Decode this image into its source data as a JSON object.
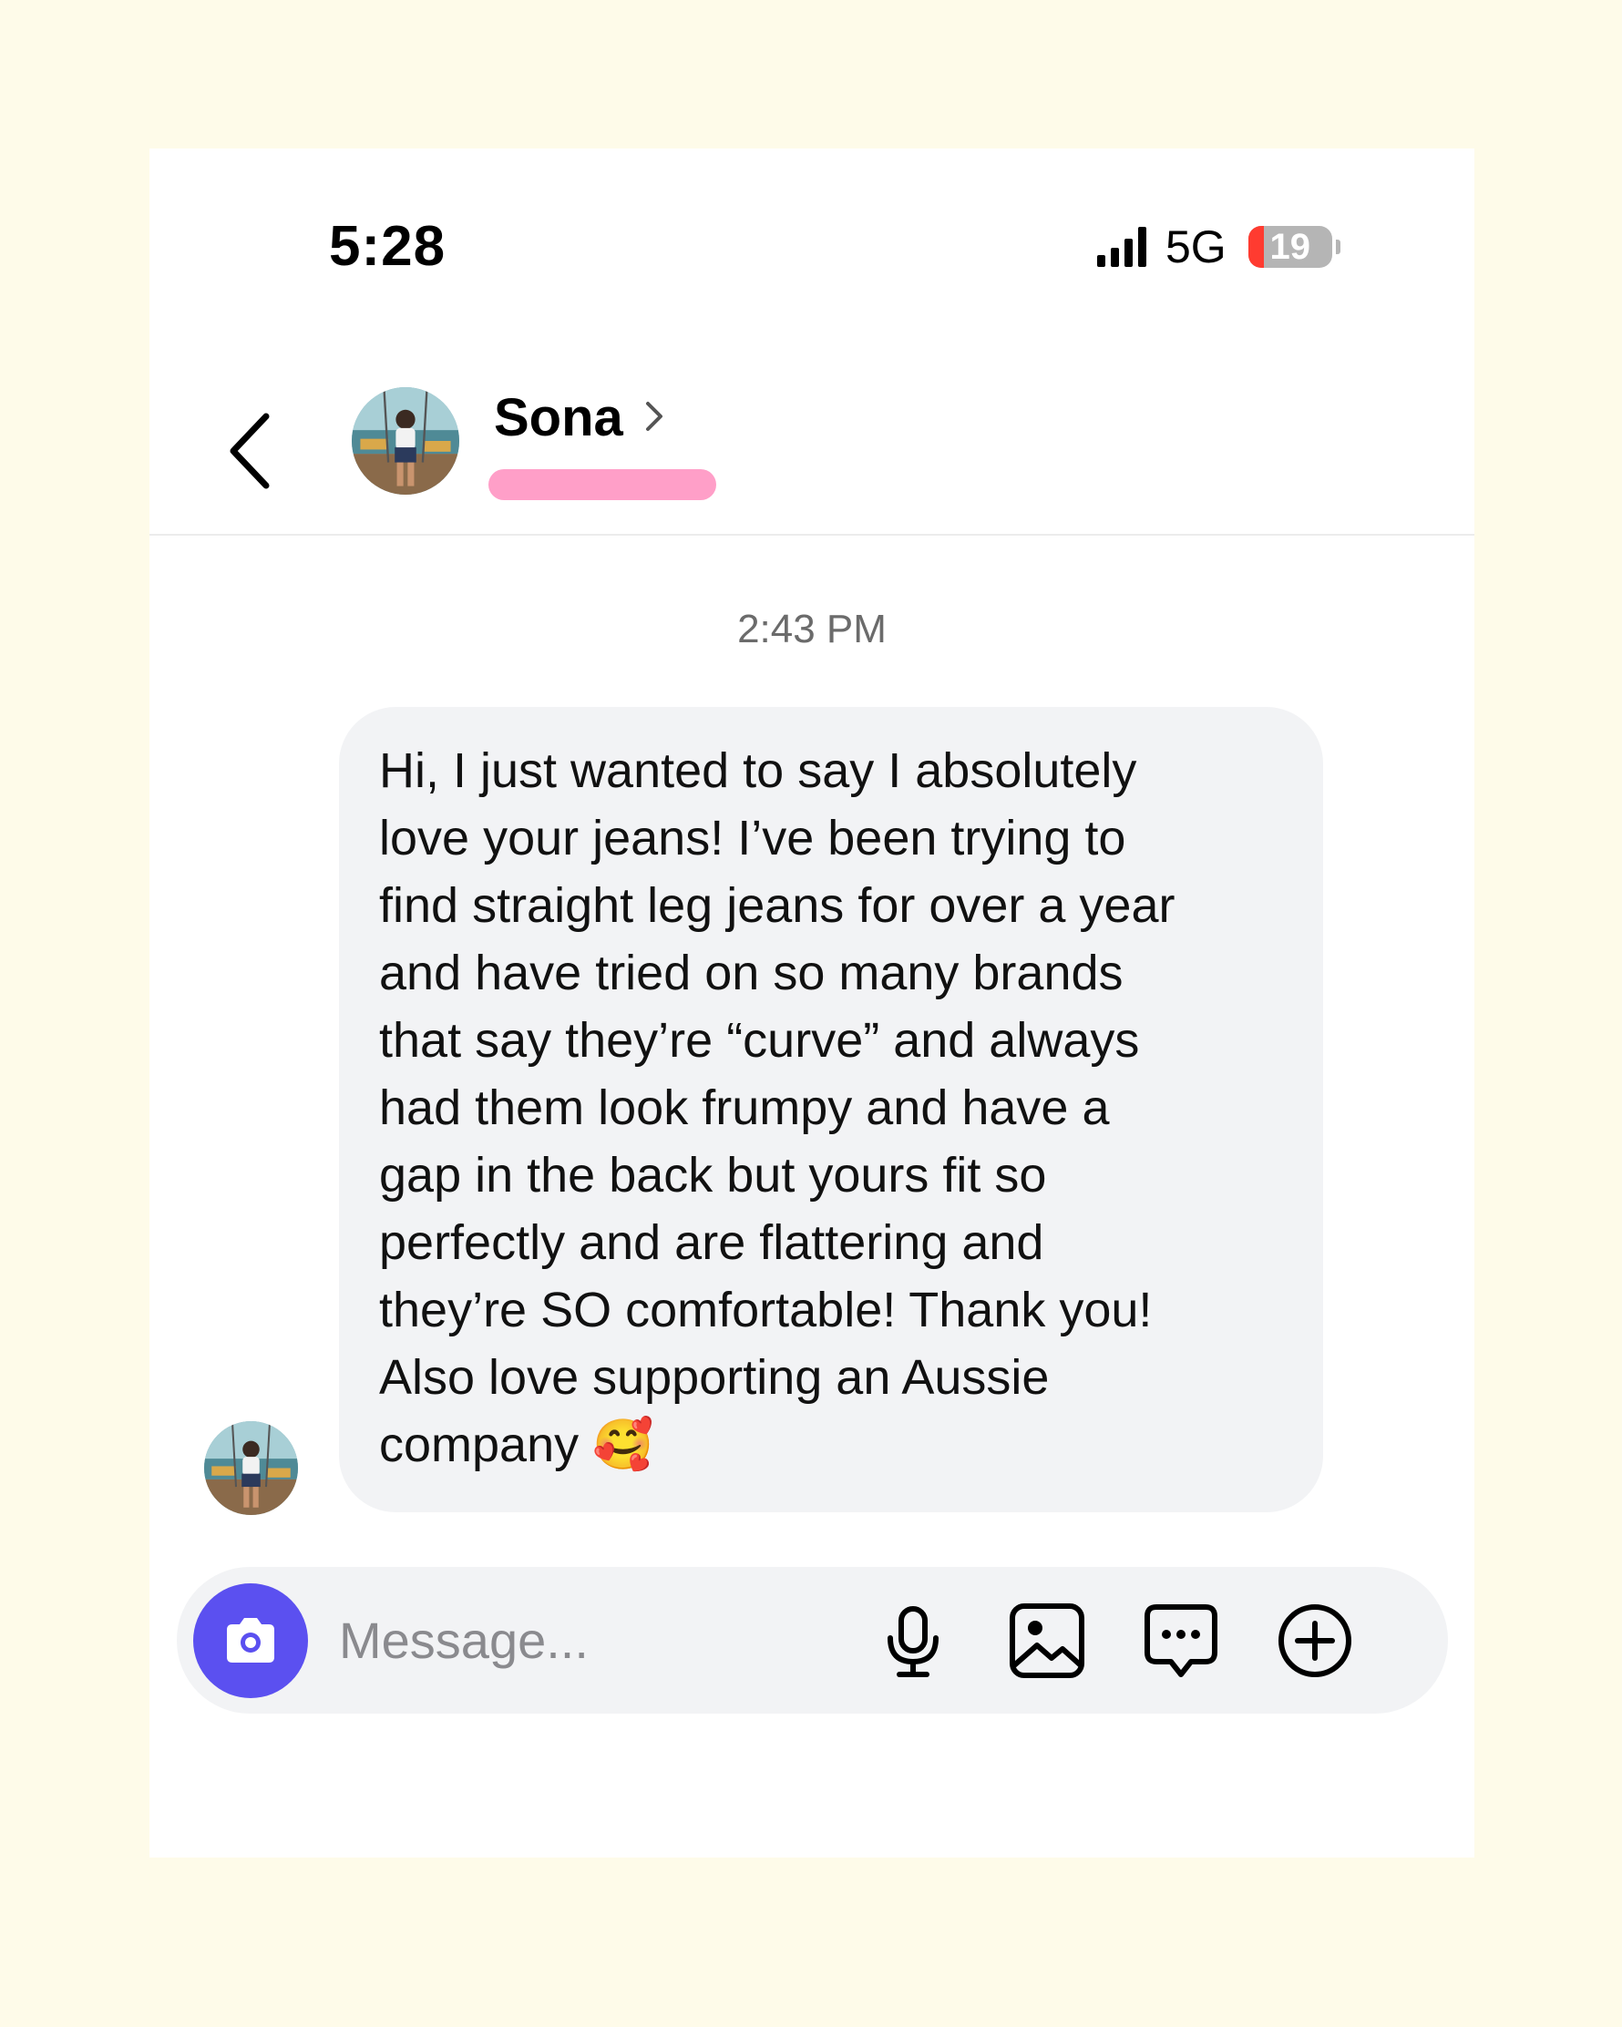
{
  "status_bar": {
    "time": "5:28",
    "network": "5G",
    "battery_level": "19"
  },
  "header": {
    "contact_name": "Sona",
    "back_icon": "chevron-left-icon",
    "profile_chevron_icon": "chevron-right-icon"
  },
  "conversation": {
    "timestamp": "2:43 PM",
    "messages": [
      {
        "sender": "Sona",
        "text": "Hi, I just wanted to say I absolutely\nlove your jeans! I’ve been trying to\nfind straight leg jeans for over a year\nand have tried on so many brands\nthat say they’re “curve” and always\nhad them look frumpy and have a\ngap in the back but yours fit so\nperfectly and are flattering and\nthey’re SO comfortable! Thank you!\nAlso love supporting an Aussie\ncompany 🥰"
      }
    ]
  },
  "composer": {
    "placeholder": "Message...",
    "icons": [
      "camera-icon",
      "microphone-icon",
      "image-icon",
      "chat-bubble-icon",
      "plus-circle-icon"
    ]
  },
  "colors": {
    "page_background": "#fefbe9",
    "camera_button": "#5b50f0",
    "bubble_background": "#f2f3f5",
    "redaction": "#ff9fc8",
    "battery_low": "#ff3b30"
  }
}
